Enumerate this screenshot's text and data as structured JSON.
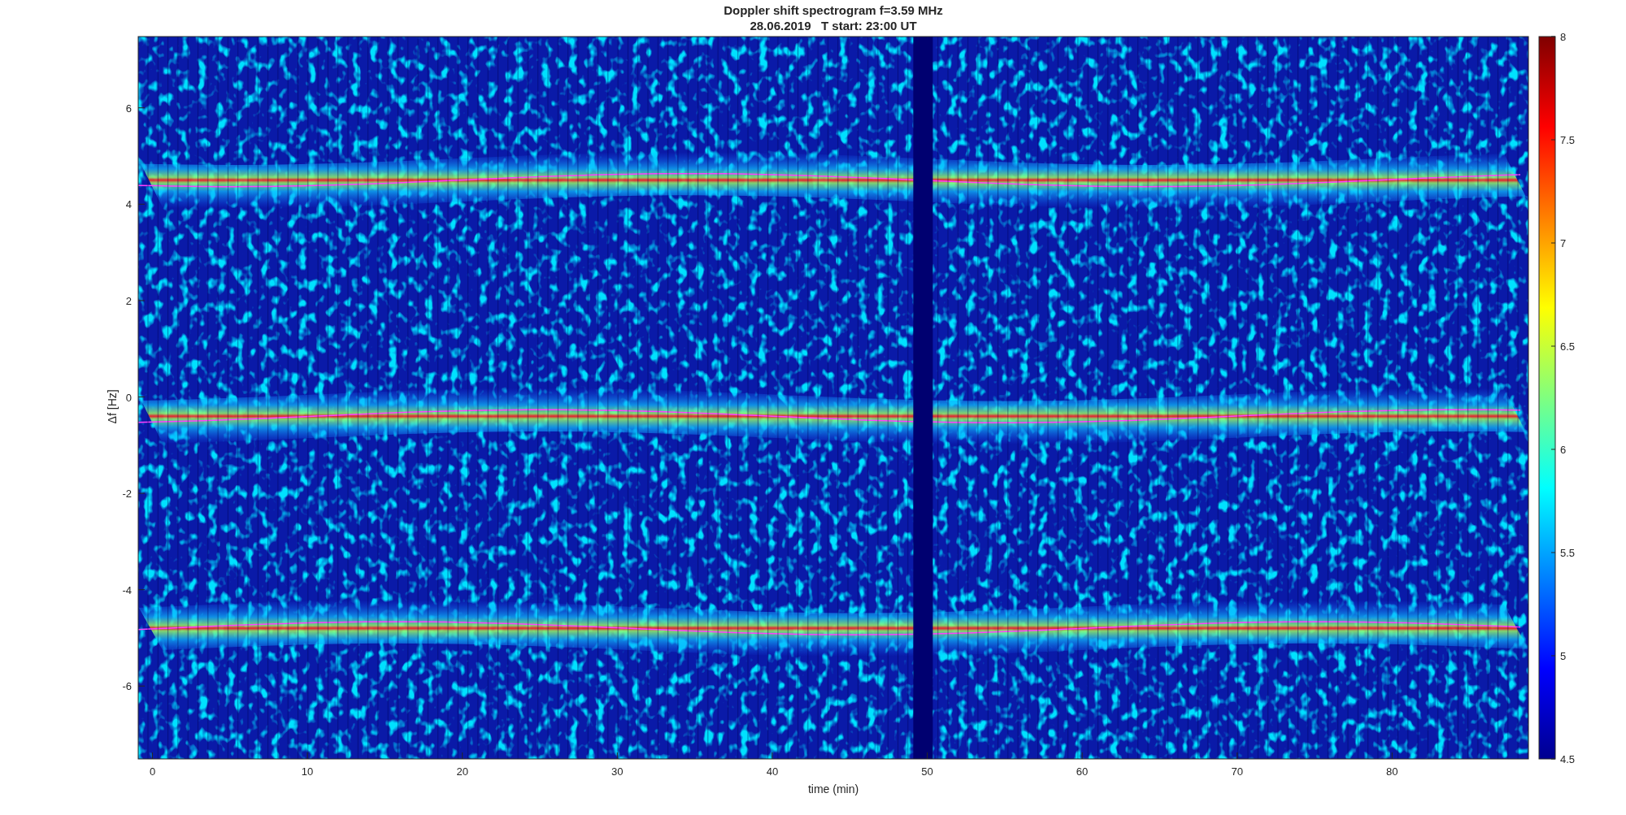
{
  "chart": {
    "title": "Doppler shift spectrogram f=3.59 MHz",
    "subtitle": "28.06.2019   T start: 23:00 UT",
    "xlabel": "time (min)",
    "ylabel": "Δf [Hz]",
    "xticks": [
      "0",
      "10",
      "20",
      "30",
      "40",
      "50",
      "60",
      "70",
      "80"
    ],
    "yticks": [
      "6",
      "4",
      "2",
      "0",
      "-2",
      "-4",
      "-6"
    ],
    "colorbar_ticks": [
      "8",
      "7.5",
      "7",
      "6.5",
      "6",
      "5.5",
      "5",
      "4.5"
    ]
  }
}
